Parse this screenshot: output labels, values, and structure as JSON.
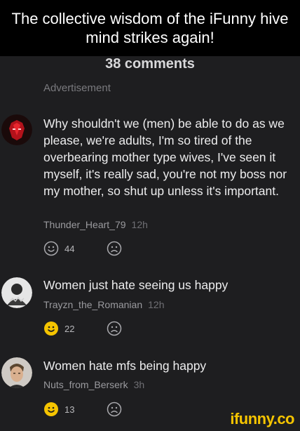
{
  "caption": "The collective wisdom of the iFunny hive mind strikes again!",
  "comments_header": "38 comments",
  "advertisement_label": "Advertisement",
  "comments": [
    {
      "text": "Why shouldn't we (men) be able to do as we please, we're adults, I'm so tired of the overbearing mother type wives, I've seen it myself, it's really sad, you're not my boss nor my mother, so shut up unless it's important.",
      "user": "Thunder_Heart_79",
      "time": "12h",
      "smiles": "44",
      "smile_active": false
    },
    {
      "text": "Women just hate seeing us happy",
      "user": "Trayzn_the_Romanian",
      "time": "12h",
      "smiles": "22",
      "smile_active": true
    },
    {
      "text": "Women hate mfs being happy",
      "user": "Nuts_from_Berserk",
      "time": "3h",
      "smiles": "13",
      "smile_active": true
    }
  ],
  "watermark": "ifunny.co",
  "colors": {
    "background": "#1e1e20",
    "smile_active": "#f5c400",
    "smile_inactive": "#a9a9ad"
  }
}
